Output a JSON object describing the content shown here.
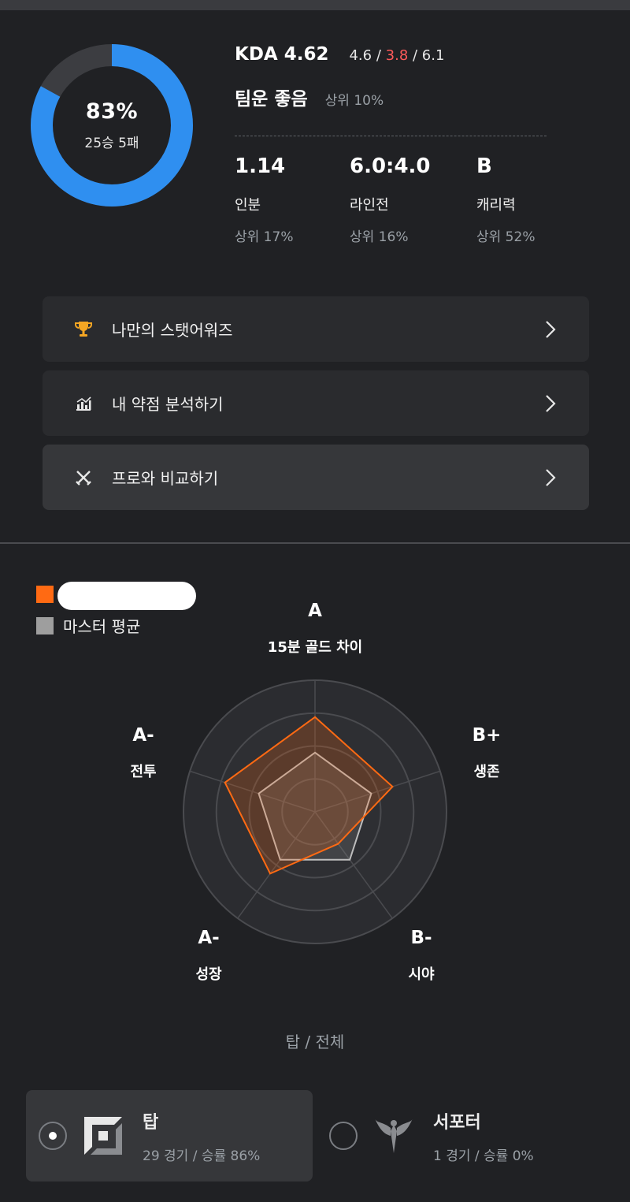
{
  "summary": {
    "win_rate": "83%",
    "record": "25승 5패",
    "win_fraction": 0.83,
    "kda_label": "KDA 4.62",
    "kda_k": "4.6",
    "kda_d": "3.8",
    "kda_a": "6.1",
    "sep1": " / ",
    "sep2": " / ",
    "luck_label": "팀운 좋음",
    "luck_rank": "상위 10%"
  },
  "stats": [
    {
      "value": "1.14",
      "label": "인분",
      "rank": "상위 17%"
    },
    {
      "value": "6.0:4.0",
      "label": "라인전",
      "rank": "상위 16%"
    },
    {
      "value": "B",
      "label": "캐리력",
      "rank": "상위 52%"
    }
  ],
  "menu": [
    {
      "label": "나만의 스탯어워즈",
      "icon": "trophy-icon"
    },
    {
      "label": "내 약점 분석하기",
      "icon": "chart-icon"
    },
    {
      "label": "프로와 비교하기",
      "icon": "crossed-swords-icon"
    }
  ],
  "legend": {
    "player_label": "",
    "average_label": "마스터 평균"
  },
  "radar": {
    "axes": [
      {
        "grade": "A",
        "name": "15분 골드 차이"
      },
      {
        "grade": "B+",
        "name": "생존"
      },
      {
        "grade": "B-",
        "name": "시야"
      },
      {
        "grade": "A-",
        "name": "성장"
      },
      {
        "grade": "A-",
        "name": "전투"
      }
    ],
    "player_values": [
      0.72,
      0.62,
      0.3,
      0.58,
      0.72
    ],
    "average_values": [
      0.45,
      0.45,
      0.45,
      0.45,
      0.45
    ],
    "caption": "탑 / 전체"
  },
  "positions": [
    {
      "name": "탑",
      "sub": "29 경기 / 승률 86%",
      "selected": true,
      "icon": "top-lane-icon"
    },
    {
      "name": "서포터",
      "sub": "1 경기 / 승률 0%",
      "selected": false,
      "icon": "support-icon"
    }
  ],
  "colors": {
    "win_blue": "#2f8ff0",
    "loss_gray": "#3c3d41",
    "player_orange": "#ff6a13",
    "average_gray": "#9e9e9e",
    "death_red": "#ff5a5a"
  }
}
